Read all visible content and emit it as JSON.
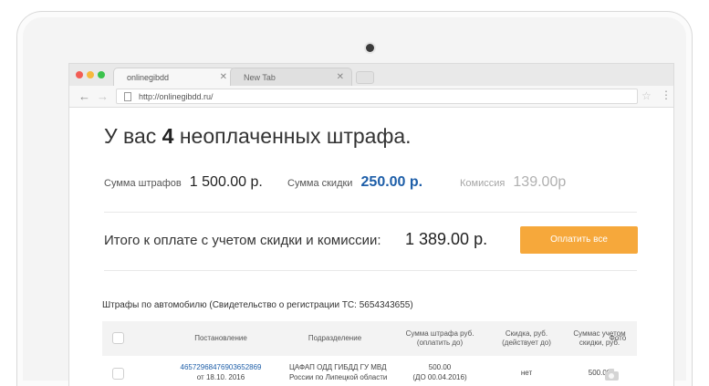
{
  "browser": {
    "tabs": [
      {
        "label": "onlinegibdd",
        "close": "✕"
      },
      {
        "label": "New Tab",
        "close": "✕"
      }
    ],
    "url": "http://onlinegibdd.ru/"
  },
  "headline": {
    "prefix": "У вас",
    "count": "4",
    "suffix": "неоплаченных штрафа."
  },
  "summary": {
    "fines_label": "Сумма штрафов",
    "fines_value": "1 500.00 р.",
    "discount_label": "Сумма скидки",
    "discount_value": "250.00 р.",
    "commission_label": "Комиссия",
    "commission_value": "139.00р"
  },
  "total": {
    "label": "Итого к оплате с учетом скидки и комиссии:",
    "value": "1 389.00 р.",
    "pay_button": "Оплатить все"
  },
  "fines_table": {
    "title": "Штрафы по автомобилю (Свидетельство о регистрации ТС:  5654343655)",
    "headers": {
      "decree": "Постановление",
      "department": "Подразделение",
      "amount": [
        "Сумма штрафа руб.",
        "(оплатить до)"
      ],
      "discount": [
        "Скидка, руб.",
        "(действует до)"
      ],
      "with_discount": [
        "Суммас учетом",
        "скидки, руб."
      ],
      "photo": "Фото"
    },
    "rows": [
      {
        "decree_number": "46572968476903652869",
        "decree_date": "от 18.10. 2016",
        "department": [
          "ЦАФАП ОДД ГИБДД ГУ МВД",
          "России по Липецкой области"
        ],
        "amount": "500.00",
        "pay_until": "(ДО 00.04.2016)",
        "discount": "нет",
        "with_discount": "500.00"
      }
    ]
  }
}
